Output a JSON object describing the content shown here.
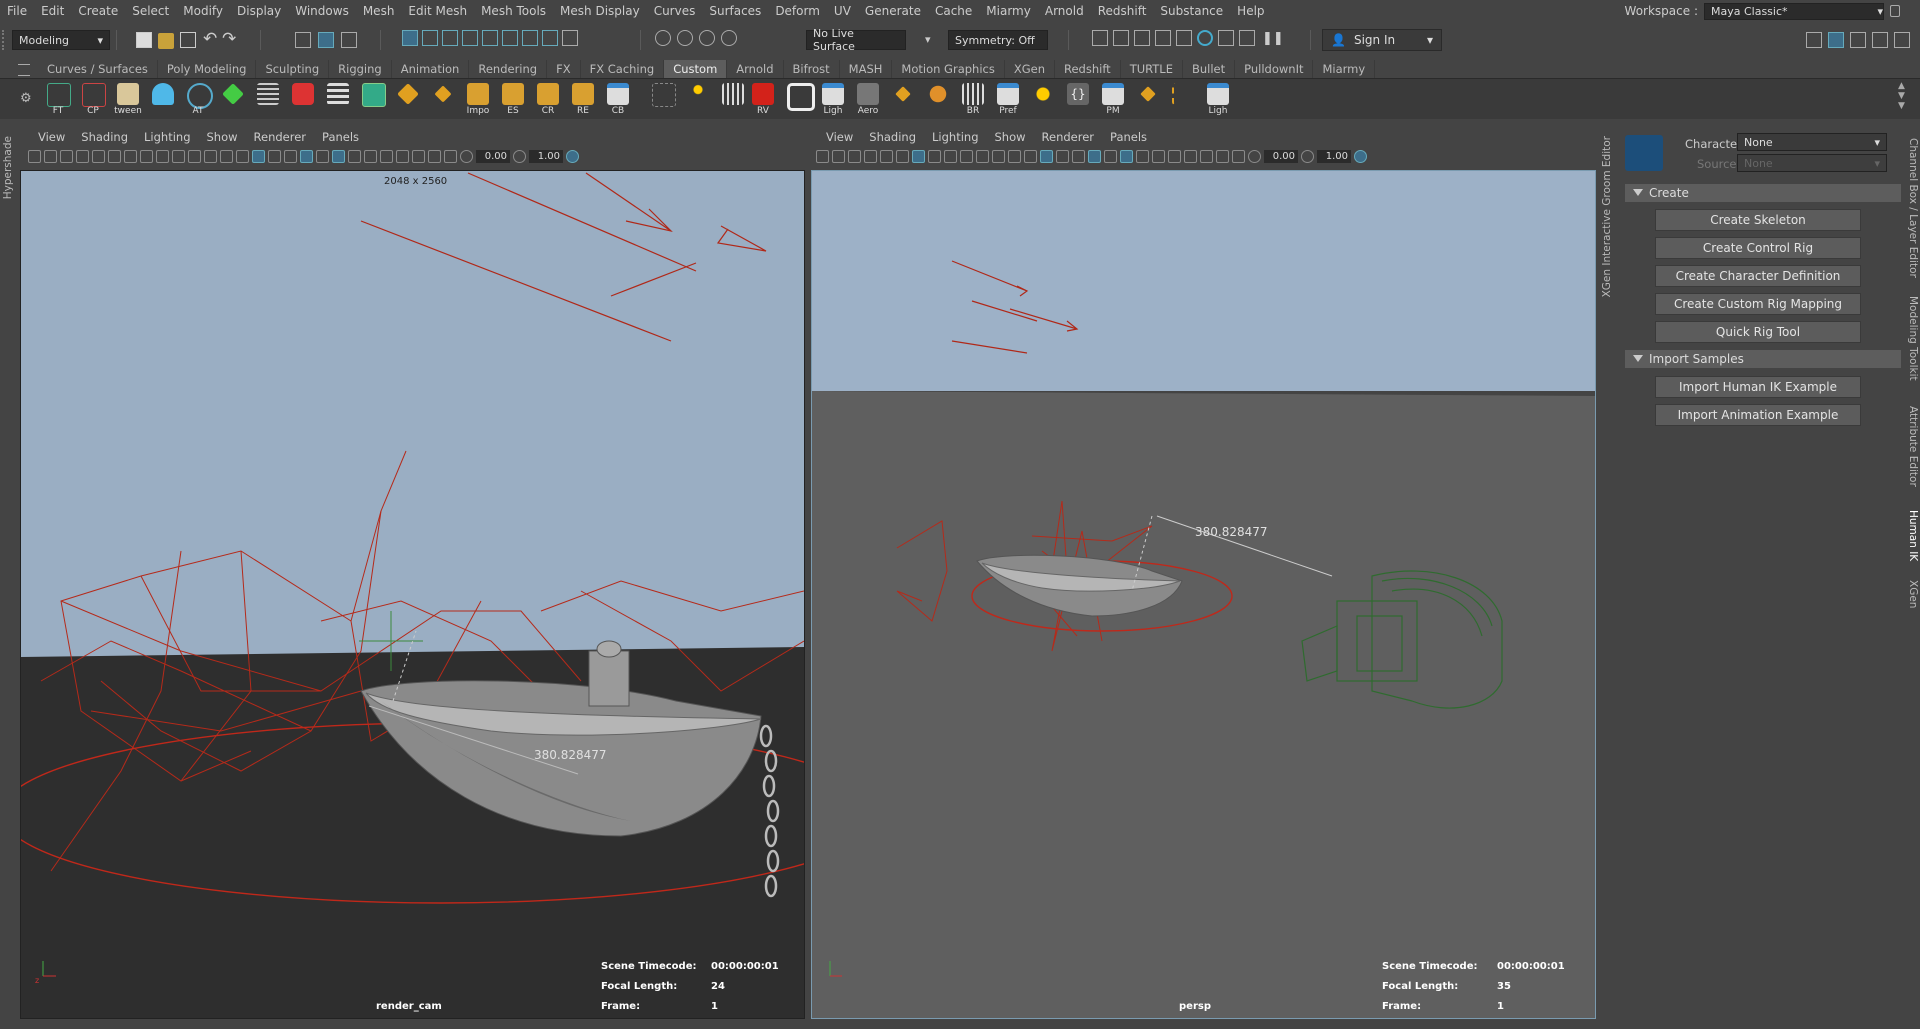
{
  "menubar": {
    "items": [
      "File",
      "Edit",
      "Create",
      "Select",
      "Modify",
      "Display",
      "Windows",
      "Mesh",
      "Edit Mesh",
      "Mesh Tools",
      "Mesh Display",
      "Curves",
      "Surfaces",
      "Deform",
      "UV",
      "Generate",
      "Cache",
      "Miarmy",
      "Arnold",
      "Redshift",
      "Substance",
      "Help"
    ],
    "workspace_label": "Workspace :",
    "workspace_value": "Maya Classic*"
  },
  "statusline": {
    "mode": "Modeling",
    "live_surface": "No Live Surface",
    "symmetry": "Symmetry: Off",
    "sign_in": "Sign In"
  },
  "shelf_tabs": {
    "items": [
      "Curves / Surfaces",
      "Poly Modeling",
      "Sculpting",
      "Rigging",
      "Animation",
      "Rendering",
      "FX",
      "FX Caching",
      "Custom",
      "Arnold",
      "Bifrost",
      "MASH",
      "Motion Graphics",
      "XGen",
      "Redshift",
      "TURTLE",
      "Bullet",
      "PulldownIt",
      "Miarmy"
    ],
    "active": "Custom"
  },
  "shelf": {
    "buttons": [
      "FT",
      "CP",
      "tween",
      "",
      "AT",
      "",
      "",
      "",
      "",
      "",
      "",
      "",
      "Impo",
      "ES",
      "CR",
      "RE",
      "CB",
      "",
      "",
      "",
      "RV",
      "",
      "Ligh",
      "Aero",
      "",
      "",
      "BR",
      "Pref",
      "",
      "",
      "PM",
      "",
      "",
      "Ligh"
    ]
  },
  "left_strip": {
    "label": "Hypershade"
  },
  "viewport_left": {
    "menu": [
      "View",
      "Shading",
      "Lighting",
      "Show",
      "Renderer",
      "Panels"
    ],
    "near_clip": "0.00",
    "far_clip": "1.00",
    "resolution": "2048 x 2560",
    "measure": "380.828477",
    "hud": {
      "timecode_label": "Scene Timecode:",
      "timecode": "00:00:00:01",
      "focal_label": "Focal Length:",
      "focal": "24",
      "frame_label": "Frame:",
      "frame": "1"
    },
    "camera": "render_cam"
  },
  "viewport_right": {
    "menu": [
      "View",
      "Shading",
      "Lighting",
      "Show",
      "Renderer",
      "Panels"
    ],
    "near_clip": "0.00",
    "far_clip": "1.00",
    "measure": "380.828477",
    "hud": {
      "timecode_label": "Scene Timecode:",
      "timecode": "00:00:00:01",
      "focal_label": "Focal Length:",
      "focal": "35",
      "frame_label": "Frame:",
      "frame": "1"
    },
    "camera": "persp"
  },
  "xgen_strip": {
    "label": "XGen Interactive Groom Editor"
  },
  "human_ik": {
    "character_label": "Character:",
    "character_value": "None",
    "source_label": "Source:",
    "source_value": "None",
    "create_header": "Create",
    "create_buttons": [
      "Create Skeleton",
      "Create Control Rig",
      "Create Character Definition",
      "Create Custom Rig Mapping",
      "Quick Rig Tool"
    ],
    "import_header": "Import Samples",
    "import_buttons": [
      "Import Human IK Example",
      "Import Animation Example"
    ]
  },
  "right_strip": {
    "tabs": [
      "Channel Box / Layer Editor",
      "Modeling Toolkit",
      "Attribute Editor",
      "Human IK",
      "XGen"
    ]
  },
  "colors": {
    "accent_blue": "#5a9fc4",
    "wire_red": "#c0281a",
    "sky_left": "#9aaec3",
    "sky_right": "#9db1c7",
    "ground_right": "#5f5f5f",
    "ground_left": "#2e2e2e"
  }
}
